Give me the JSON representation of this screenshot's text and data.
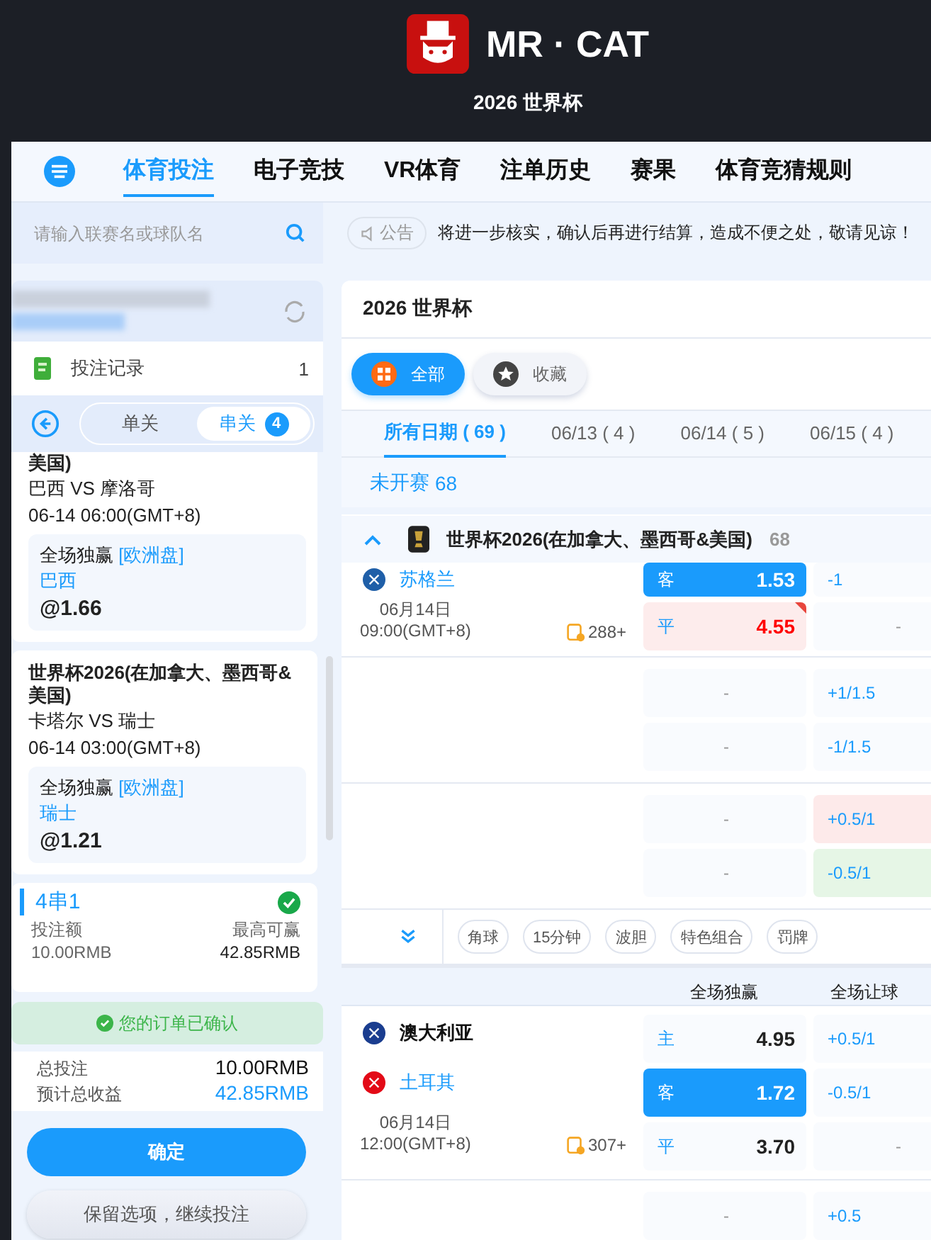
{
  "header": {
    "brand": "MR · CAT",
    "subtitle": "2026 世界杯"
  },
  "nav": {
    "tabs": [
      {
        "label": "体育投注",
        "selected": true
      },
      {
        "label": "电子竞技",
        "selected": false
      },
      {
        "label": "VR体育",
        "selected": false
      },
      {
        "label": "注单历史",
        "selected": false
      },
      {
        "label": "赛果",
        "selected": false
      },
      {
        "label": "体育竞猜规则",
        "selected": false
      }
    ]
  },
  "search": {
    "placeholder": "请输入联赛名或球队名"
  },
  "notice": {
    "badge": "公告",
    "text": "将进一步核实，确认后再进行结算，造成不便之处，敬请见谅！"
  },
  "betslip": {
    "record_label": "投注记录",
    "record_count": "1",
    "tabs": [
      {
        "label": "单关",
        "selected": false
      },
      {
        "label": "串关",
        "selected": true,
        "count": "4"
      }
    ],
    "selections": [
      {
        "league": "美国)",
        "match": "巴西 VS 摩洛哥",
        "time": "06-14 06:00(GMT+8)",
        "market": "全场独赢",
        "market_type": "[欧洲盘]",
        "pick": "巴西",
        "odds": "@1.66"
      },
      {
        "league": "世界杯2026(在加拿大、墨西哥&美国)",
        "match": "卡塔尔 VS 瑞士",
        "time": "06-14 03:00(GMT+8)",
        "market": "全场独赢",
        "market_type": "[欧洲盘]",
        "pick": "瑞士",
        "odds": "@1.21"
      }
    ],
    "combo": {
      "title": "4串1",
      "confirmed": true,
      "stake_label": "投注额",
      "max_win_label": "最高可赢",
      "stake": "10.00RMB",
      "max_win": "42.85RMB"
    },
    "confirmation": "您的订单已确认",
    "totals": [
      {
        "label": "总投注",
        "value": "10.00RMB",
        "kind": "plain"
      },
      {
        "label": "预计总收益",
        "value": "42.85RMB",
        "kind": "highlight"
      }
    ],
    "buttons": [
      {
        "label": "确定",
        "kind": "primary"
      },
      {
        "label": "保留选项，继续投注",
        "kind": "secondary"
      }
    ]
  },
  "events": {
    "title": "2026 世界杯",
    "filters": [
      {
        "label": "全部",
        "selected": true
      },
      {
        "label": "收藏",
        "selected": false
      }
    ],
    "date_tabs": [
      {
        "label": "所有日期 ( 69 )",
        "selected": true
      },
      {
        "label": "06/13 ( 4 )",
        "selected": false
      },
      {
        "label": "06/14 ( 5 )",
        "selected": false
      },
      {
        "label": "06/15 ( 4 )",
        "selected": false
      }
    ],
    "status": "未开赛",
    "status_count": "68",
    "league": {
      "name": "世界杯2026(在加拿大、墨西哥&美国)",
      "count": "68",
      "expanded": true
    },
    "matches": [
      {
        "date": "06月14日",
        "clock": "09:00(GMT+8)",
        "markets": "288+",
        "teams": [
          {
            "name": "苏格兰",
            "color": "#1f5fa8",
            "picked": true
          }
        ],
        "lines": [
          {
            "outcome": "客",
            "odds": "1.53",
            "selected": true,
            "odds_up": false,
            "handicap": "-1",
            "handicap_blank": false,
            "handicap_up": false,
            "handicap_down": false
          },
          {
            "outcome": "平",
            "odds": "4.55",
            "selected": false,
            "odds_up": true,
            "handicap": "-",
            "handicap_blank": true,
            "handicap_up": false,
            "handicap_down": false
          }
        ],
        "extra_groups": [
          [
            {
              "odds": "-",
              "handicap": "+1/1.5",
              "handicap_up": false,
              "handicap_down": false
            },
            {
              "odds": "-",
              "handicap": "-1/1.5",
              "handicap_up": false,
              "handicap_down": false
            }
          ],
          [
            {
              "odds": "-",
              "handicap": "+0.5/1",
              "handicap_up": true,
              "handicap_down": false
            },
            {
              "odds": "-",
              "handicap": "-0.5/1",
              "handicap_up": false,
              "handicap_down": true
            }
          ]
        ],
        "more_markets": [
          "角球",
          "15分钟",
          "波胆",
          "特色组合",
          "罚牌"
        ]
      },
      {
        "columns": [
          "全场独赢",
          "全场让球"
        ],
        "date": "06月14日",
        "clock": "12:00(GMT+8)",
        "markets": "307+",
        "teams": [
          {
            "name": "澳大利亚",
            "color": "#1a3d8f",
            "picked": false
          },
          {
            "name": "土耳其",
            "color": "#e30a17",
            "picked": true
          }
        ],
        "lines": [
          {
            "outcome": "主",
            "odds": "4.95",
            "selected": false,
            "odds_up": false,
            "handicap": "+0.5/1",
            "handicap_blank": false,
            "handicap_up": false,
            "handicap_down": false
          },
          {
            "outcome": "客",
            "odds": "1.72",
            "selected": true,
            "odds_up": false,
            "handicap": "-0.5/1",
            "handicap_blank": false,
            "handicap_up": false,
            "handicap_down": false
          },
          {
            "outcome": "平",
            "odds": "3.70",
            "selected": false,
            "odds_up": false,
            "handicap": "-",
            "handicap_blank": true,
            "handicap_up": false,
            "handicap_down": false
          }
        ],
        "extra_groups": [
          [
            {
              "odds": "-",
              "handicap": "+0.5",
              "handicap_up": false,
              "handicap_down": false
            }
          ]
        ]
      }
    ]
  }
}
